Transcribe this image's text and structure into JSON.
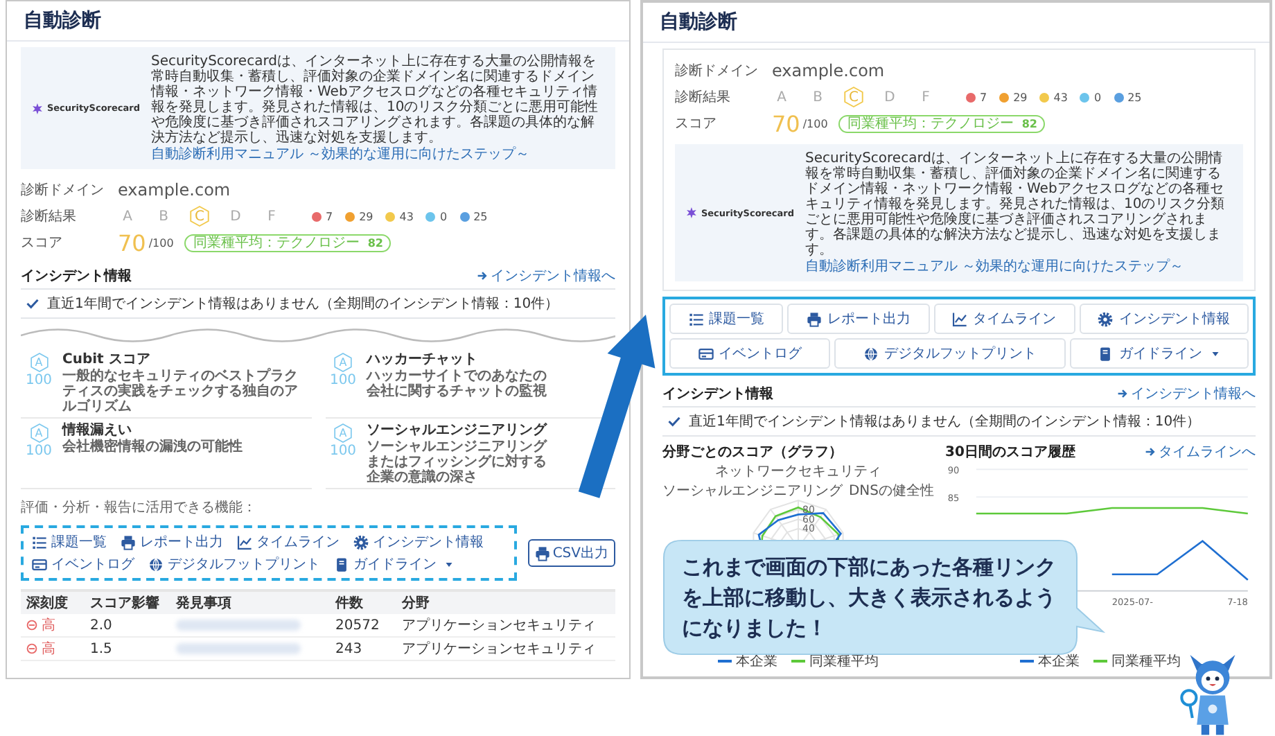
{
  "before": {
    "title": "自動診断",
    "banner": {
      "logo_text": "SecurityScorecard",
      "description": "SecurityScorecardは、インターネット上に存在する大量の公開情報を常時自動収集・蓄積し、評価対象の企業ドメイン名に関連するドメイン情報・ネットワーク情報・Webアクセスログなどの各種セキュリティ情報を発見します。発見された情報は、10のリスク分類ごとに悪用可能性や危険度に基づき評価されスコアリングされます。各課題の具体的な解決方法など提示し、迅速な対処を支援します。",
      "link": "自動診断利用マニュアル ～効果的な運用に向けたステップ～"
    },
    "summary": {
      "domain_label": "診断ドメイン",
      "domain": "example.com",
      "result_label": "診断結果",
      "grades": [
        {
          "letter": "A",
          "selected": false
        },
        {
          "letter": "B",
          "selected": false
        },
        {
          "letter": "C",
          "selected": true
        },
        {
          "letter": "D",
          "selected": false
        },
        {
          "letter": "F",
          "selected": false
        }
      ],
      "counts": [
        {
          "value": "7",
          "color": "#e86a6a"
        },
        {
          "value": "29",
          "color": "#f0a030"
        },
        {
          "value": "43",
          "color": "#f2c94c"
        },
        {
          "value": "0",
          "color": "#6cc4ec"
        },
        {
          "value": "25",
          "color": "#5a9fe0"
        }
      ],
      "score_label": "スコア",
      "score": "70",
      "score_max": "/100",
      "industry_label": "同業種平均：テクノロジー",
      "industry_value": "82"
    },
    "incident": {
      "title": "インシデント情報",
      "link": "インシデント情報へ",
      "message": "直近1年間でインシデント情報はありません（全期間のインシデント情報：10件）"
    },
    "categories": [
      {
        "grade": "A",
        "score": "100",
        "name": "Cubit スコア",
        "description": "一般的なセキュリティのベストプラクティスの実践をチェックする独自のアルゴリズム"
      },
      {
        "grade": "A",
        "score": "100",
        "name": "ハッカーチャット",
        "description": "ハッカーサイトでのあなたの会社に関するチャットの監視"
      },
      {
        "grade": "A",
        "score": "100",
        "name": "情報漏えい",
        "description": "会社機密情報の漏洩の可能性"
      },
      {
        "grade": "A",
        "score": "100",
        "name": "ソーシャルエンジニアリング",
        "description": "ソーシャルエンジニアリングまたはフィッシングに対する企業の意識の深さ"
      }
    ],
    "features_label": "評価・分析・報告に活用できる機能：",
    "links": [
      {
        "label": "課題一覧",
        "dropdown": false
      },
      {
        "label": "レポート出力",
        "dropdown": false
      },
      {
        "label": "タイムライン",
        "dropdown": false
      },
      {
        "label": "インシデント情報",
        "dropdown": false
      },
      {
        "label": "イベントログ",
        "dropdown": false
      },
      {
        "label": "デジタルフットプリント",
        "dropdown": false
      },
      {
        "label": "ガイドライン",
        "dropdown": true
      }
    ],
    "csv_button": "CSV出力",
    "table": {
      "columns": [
        "深刻度",
        "スコア影響",
        "発見事項",
        "件数",
        "分野"
      ],
      "rows": [
        {
          "severity": "高",
          "impact": "2.0",
          "count": "20572",
          "field": "アプリケーションセキュリティ"
        },
        {
          "severity": "高",
          "impact": "1.5",
          "count": "243",
          "field": "アプリケーションセキュリティ"
        }
      ]
    }
  },
  "after": {
    "title": "自動診断",
    "summary": {
      "domain_label": "診断ドメイン",
      "domain": "example.com",
      "result_label": "診断結果",
      "grades": [
        {
          "letter": "A",
          "selected": false
        },
        {
          "letter": "B",
          "selected": false
        },
        {
          "letter": "C",
          "selected": true
        },
        {
          "letter": "D",
          "selected": false
        },
        {
          "letter": "F",
          "selected": false
        }
      ],
      "counts": [
        {
          "value": "7",
          "color": "#e86a6a"
        },
        {
          "value": "29",
          "color": "#f0a030"
        },
        {
          "value": "43",
          "color": "#f2c94c"
        },
        {
          "value": "0",
          "color": "#6cc4ec"
        },
        {
          "value": "25",
          "color": "#5a9fe0"
        }
      ],
      "score_label": "スコア",
      "score": "70",
      "score_max": "/100",
      "industry_label": "同業種平均：テクノロジー",
      "industry_value": "82"
    },
    "banner": {
      "logo_text": "SecurityScorecard",
      "description": "SecurityScorecardは、インターネット上に存在する大量の公開情報を常時自動収集・蓄積し、評価対象の企業ドメイン名に関連するドメイン情報・ネットワーク情報・Webアクセスログなどの各種セキュリティ情報を発見します。発見された情報は、10のリスク分類ごとに悪用可能性や危険度に基づき評価されスコアリングされます。各課題の具体的な解決方法など提示し、迅速な対処を支援します。",
      "link": "自動診断利用マニュアル ～効果的な運用に向けたステップ～"
    },
    "buttons": [
      {
        "label": "課題一覧",
        "dropdown": false
      },
      {
        "label": "レポート出力",
        "dropdown": false
      },
      {
        "label": "タイムライン",
        "dropdown": false
      },
      {
        "label": "インシデント情報",
        "dropdown": false
      },
      {
        "label": "イベントログ",
        "dropdown": false
      },
      {
        "label": "デジタルフットプリント",
        "dropdown": false
      },
      {
        "label": "ガイドライン",
        "dropdown": true
      }
    ],
    "incident": {
      "title": "インシデント情報",
      "link": "インシデント情報へ",
      "message": "直近1年間でインシデント情報はありません（全期間のインシデント情報：10件）"
    },
    "radar": {
      "title": "分野ごとのスコア（グラフ）",
      "axis_labels": [
        "ネットワークセキュリティ",
        "ソーシャルエンジニアリング",
        "DNSの健全性"
      ],
      "ticks": [
        "80",
        "60",
        "40"
      ],
      "legend": [
        "本企業",
        "同業種平均"
      ]
    },
    "history": {
      "link": "タイムラインへ",
      "x_labels": [
        "2025-07-",
        "7-18"
      ],
      "chart_data": {
        "type": "line",
        "title": "30日間のスコア履歴",
        "ylim": [
          68,
          90
        ],
        "yticks": [
          85,
          90
        ],
        "series": [
          {
            "name": "本企業",
            "color": "#1f6fd1",
            "values": [
              null,
              null,
              null,
              71,
              71,
              77,
              70
            ]
          },
          {
            "name": "同業種平均",
            "color": "#5dc93a",
            "values": [
              82,
              82,
              82,
              83,
              83,
              83,
              82
            ]
          }
        ]
      }
    }
  },
  "callout": {
    "text": "これまで画面の下部にあった各種リンクを上部に移動し、大きく表示されるようになりました！"
  }
}
